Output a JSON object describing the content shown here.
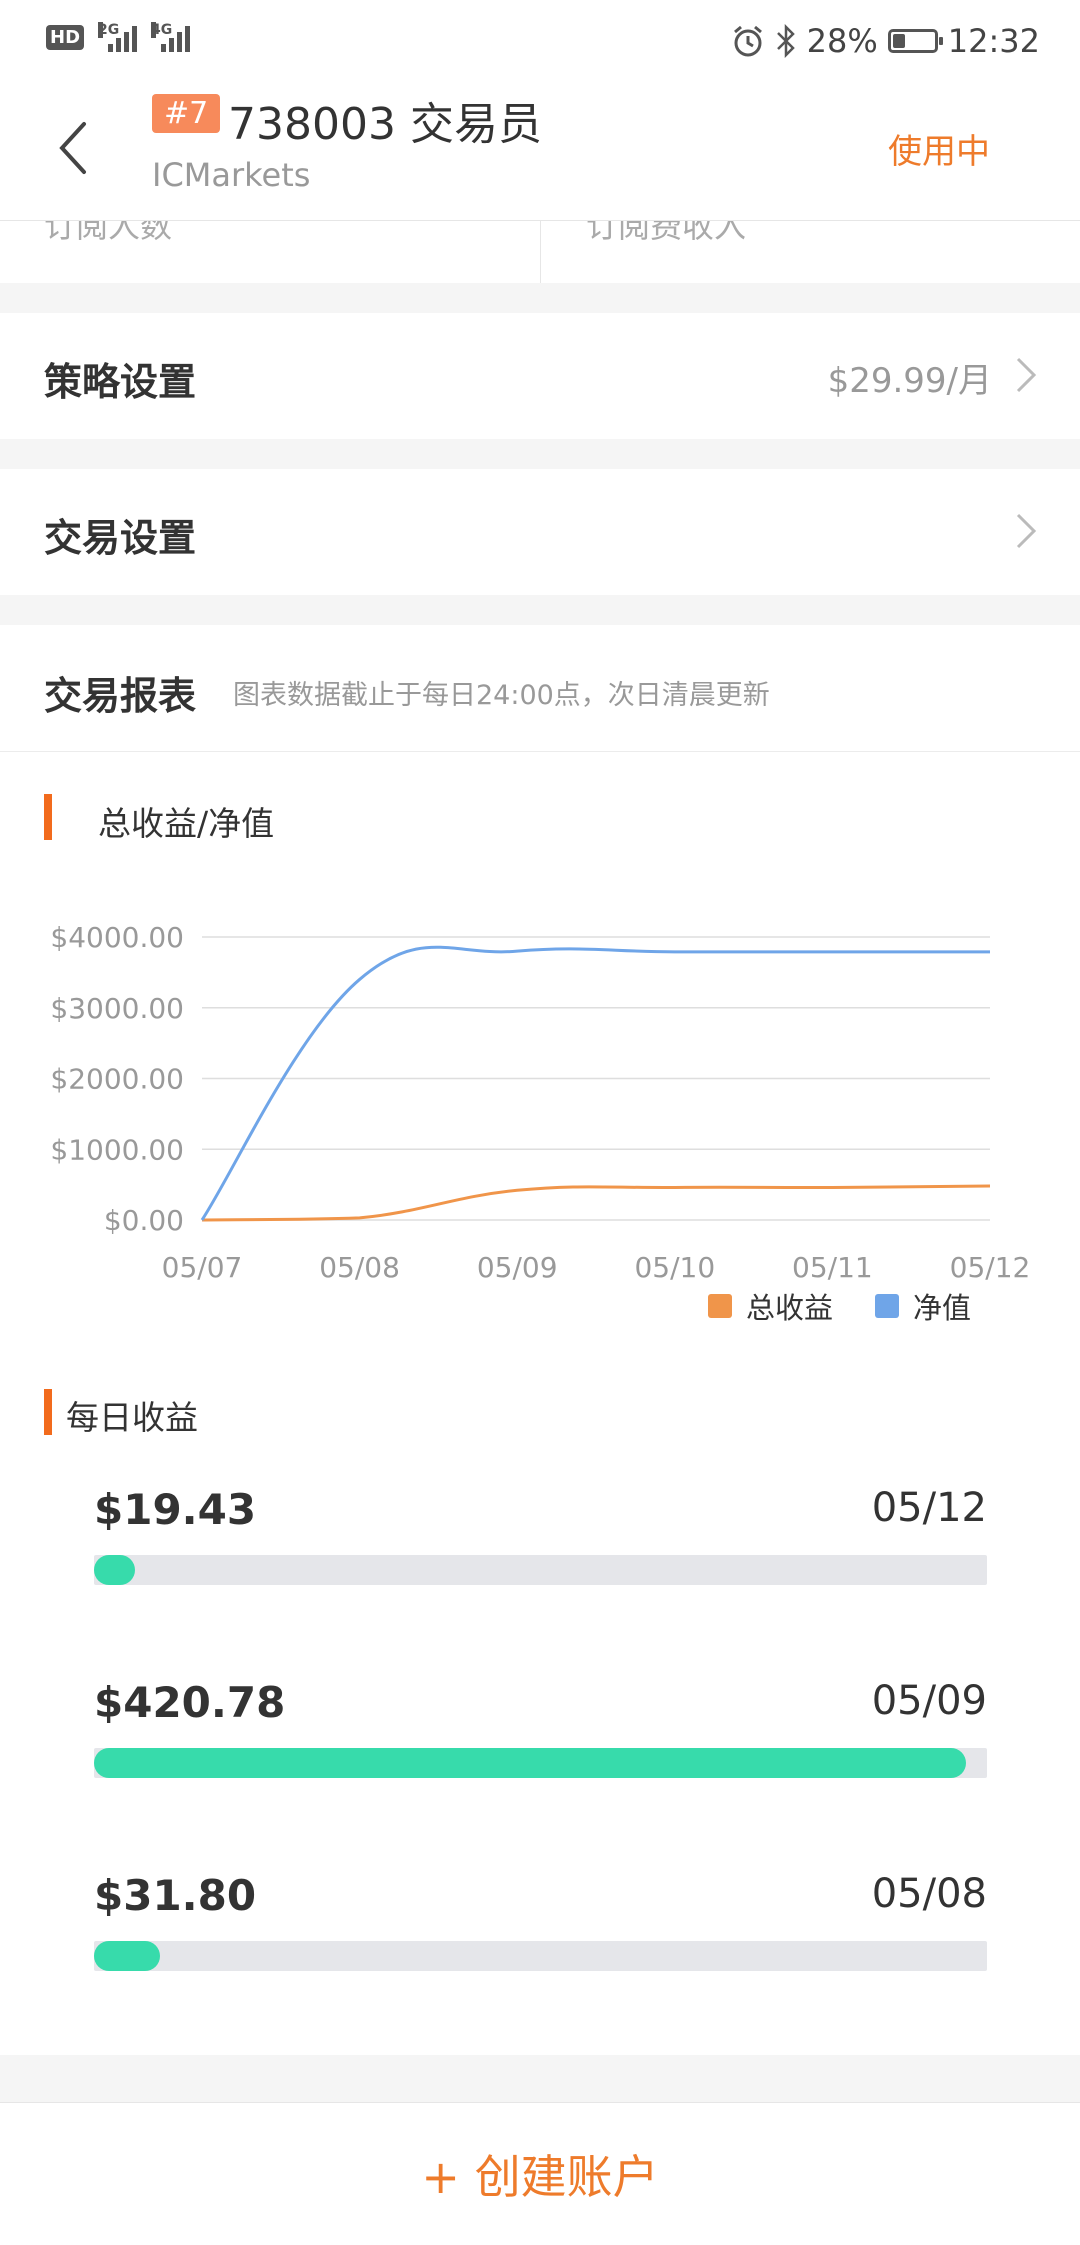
{
  "status_bar": {
    "network_badge": "HD",
    "net_2g": "2G",
    "net_4g": "4G",
    "battery_text": "28%",
    "battery_level": 0.28,
    "time": "12:32"
  },
  "header": {
    "rank": "#7",
    "title": "738003 交易员",
    "broker": "ICMarkets",
    "status": "使用中"
  },
  "stats": {
    "left_label": "订阅人数",
    "right_label": "订阅费收入"
  },
  "strategy_row": {
    "label": "策略设置",
    "value": "$29.99/月"
  },
  "trade_row": {
    "label": "交易设置"
  },
  "report": {
    "title": "交易报表",
    "note": "图表数据截止于每日24:00点，次日清晨更新",
    "chart_title": "总收益/净值",
    "daily_title": "每日收益"
  },
  "chart_data": {
    "type": "line",
    "x": [
      "05/07",
      "05/08",
      "05/09",
      "05/10",
      "05/11",
      "05/12"
    ],
    "ylim": [
      0,
      4000
    ],
    "y_ticks": [
      "$0.00",
      "$1000.00",
      "$2000.00",
      "$3000.00",
      "$4000.00"
    ],
    "grid": true,
    "legend_position": "bottom-right",
    "series": [
      {
        "name": "总收益",
        "color": "#f0954a",
        "values": [
          0,
          30,
          420,
          460,
          460,
          480
        ]
      },
      {
        "name": "净值",
        "color": "#6fa5e8",
        "values": [
          0,
          3400,
          3800,
          3790,
          3790,
          3790
        ]
      }
    ]
  },
  "daily_profits": [
    {
      "amount": "$19.43",
      "date": "05/12",
      "fraction": 0.046
    },
    {
      "amount": "$420.78",
      "date": "05/09",
      "fraction": 0.976
    },
    {
      "amount": "$31.80",
      "date": "05/08",
      "fraction": 0.074
    }
  ],
  "bottom": {
    "create_label": "+ 创建账户"
  },
  "colors": {
    "accent": "#ee7b2b",
    "rank_badge": "#f78a5b",
    "progress": "#37dbab",
    "section_bar": "#f26b1d"
  }
}
